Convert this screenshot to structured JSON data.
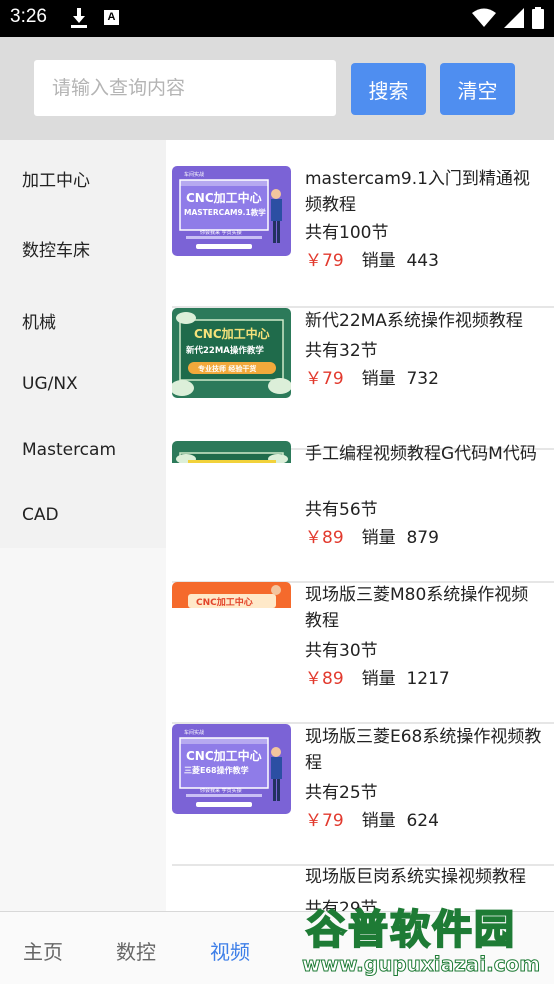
{
  "status_bar": {
    "time": "3:26"
  },
  "search": {
    "placeholder": "请输入查询内容",
    "search_label": "搜索",
    "clear_label": "清空"
  },
  "sidebar": {
    "items": [
      {
        "label": "加工中心"
      },
      {
        "label": "数控车床"
      },
      {
        "label": "机械"
      },
      {
        "label": "UG/NX"
      },
      {
        "label": "Mastercam"
      },
      {
        "label": "CAD"
      }
    ]
  },
  "courses": [
    {
      "title": "mastercam9.1入门到精通视频教程",
      "lessons": "共有100节",
      "price": "￥79",
      "sales_label": "销量",
      "sales": "443",
      "thumb": {
        "heading": "CNC加工中心",
        "sub": "MASTERCAM9.1教学",
        "small": "车间实战",
        "foot": "你会我来 学员实操"
      }
    },
    {
      "title": "新代22MA系统操作视频教程",
      "lessons": "共有32节",
      "price": "￥79",
      "sales_label": "销量",
      "sales": "732",
      "thumb": {
        "heading": "CNC加工中心",
        "sub": "新代22MA操作教学",
        "foot": "专业技师 经验干货"
      }
    },
    {
      "title": "手工编程视频教程G代码M代码",
      "lessons": "共有56节",
      "price": "￥89",
      "sales_label": "销量",
      "sales": "879"
    },
    {
      "title": "现场版三菱M80系统操作视频教程",
      "lessons": "共有30节",
      "price": "￥89",
      "sales_label": "销量",
      "sales": "1217",
      "thumb": {
        "heading": "CNC加工中心"
      }
    },
    {
      "title": "现场版三菱E68系统操作视频教程",
      "lessons": "共有25节",
      "price": "￥79",
      "sales_label": "销量",
      "sales": "624",
      "thumb": {
        "heading": "CNC加工中心",
        "sub": "三菱E68操作教学",
        "small": "车间实战",
        "foot": "你会我来 学员实操"
      }
    },
    {
      "title": "现场版巨岗系统实操视频教程",
      "lessons": "共有29节"
    }
  ],
  "bottom_nav": {
    "items": [
      {
        "label": "主页"
      },
      {
        "label": "数控"
      },
      {
        "label": "视频"
      }
    ]
  },
  "watermark": {
    "title": "谷普软件园",
    "url": "www.gupuxiazai.com"
  },
  "colors": {
    "accent": "#4f8ef0",
    "price": "#e23a2e",
    "nav_active": "#3e7fe8"
  }
}
